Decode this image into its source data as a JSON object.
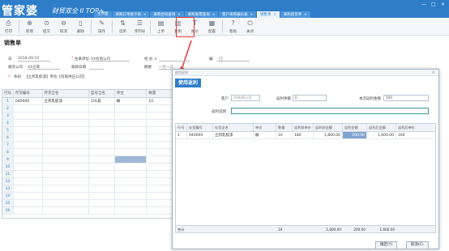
{
  "app": {
    "logo": "管家婆",
    "logo_sub": "财贸双全 II TOP+"
  },
  "tabs": [
    {
      "label": "主界面",
      "close": ""
    },
    {
      "label": "采购订单统计表",
      "close": "×"
    },
    {
      "label": "采购合同查询",
      "close": "×"
    },
    {
      "label": "采购发票查询",
      "close": "×"
    },
    {
      "label": "客户采购报价表",
      "close": "×"
    },
    {
      "label": "销售单",
      "close": "×"
    },
    {
      "label": "采购退货单",
      "close": "×"
    }
  ],
  "window_controls": {
    "minimize": "—",
    "maximize": "□",
    "close": "×"
  },
  "toolbar": {
    "buttons": [
      {
        "icon": "⎙",
        "label": "打印"
      },
      {
        "icon": "⊕",
        "label": "新增"
      },
      {
        "icon": "⊙",
        "label": "提交"
      },
      {
        "icon": "⊖",
        "label": "取消"
      },
      {
        "icon": "▯",
        "label": "删除"
      },
      {
        "icon": "✎",
        "label": "操作"
      },
      {
        "icon": "⇅",
        "label": "选单"
      },
      {
        "icon": "☰",
        "label": "序列号"
      },
      {
        "icon": "▤",
        "label": "上单"
      },
      {
        "icon": "▥",
        "label": "复制"
      },
      {
        "icon": "T",
        "label": "报价"
      },
      {
        "icon": "▦",
        "label": "配置"
      },
      {
        "icon": "?",
        "label": "帮助"
      },
      {
        "icon": "⏻",
        "label": "关闭"
      }
    ]
  },
  "doc": {
    "title": "销售单",
    "fields": {
      "date_label": "日",
      "date_value": "2018-09-10",
      "unit_label": "往来单位",
      "unit_value": "XX有限公司",
      "handler_label": "经 办 人",
      "doc_no_label": "编",
      "doc_no_value": "门",
      "dept_label": "收货公司",
      "dept_value": "XX仓库",
      "checkout_label": "收款日期",
      "summary_label": "摘要",
      "summary_value": "一月一日",
      "barcode_label": "条码",
      "barcode_value": "【立邦乳胶漆】单位【有限供应公司】"
    }
  },
  "main_grid": {
    "columns": [
      "行号",
      "存货编号",
      "存货全名",
      "型号全名",
      "单位",
      "数量"
    ],
    "rows": [
      [
        "1",
        "040000",
        "立邦乳胶漆",
        "10L套",
        "桶",
        "10"
      ],
      [
        "2",
        "",
        "",
        "",
        "",
        ""
      ],
      [
        "3",
        "",
        "",
        "",
        "",
        ""
      ],
      [
        "4",
        "",
        "",
        "",
        "",
        ""
      ],
      [
        "5",
        "",
        "",
        "",
        "",
        ""
      ],
      [
        "6",
        "",
        "",
        "",
        "",
        ""
      ],
      [
        "7",
        "",
        "",
        "",
        "",
        ""
      ],
      [
        "8",
        "",
        "",
        "",
        "",
        ""
      ],
      [
        "9",
        "",
        "",
        "",
        "",
        ""
      ],
      [
        "10",
        "",
        "",
        "",
        "",
        ""
      ],
      [
        "11",
        "",
        "",
        "",
        "",
        ""
      ],
      [
        "12",
        "",
        "",
        "",
        "",
        ""
      ],
      [
        "13",
        "",
        "",
        "",
        "",
        ""
      ],
      [
        "14",
        "",
        "",
        "",
        "",
        ""
      ],
      [
        "15",
        "",
        "",
        "",
        "",
        ""
      ],
      [
        "16",
        "",
        "",
        "",
        "",
        ""
      ]
    ]
  },
  "dialog": {
    "title": "使用返利",
    "header": "使用返利",
    "close": "×",
    "customer_label": "客户",
    "customer_value": "XX有限公司",
    "rebate_amount_label": "返利余额",
    "rebate_amount_value": "0",
    "this_rebate_label": "本次返利金额",
    "this_rebate_value": "500",
    "rebate_note_label": "返利说明",
    "rebate_note_value": "",
    "grid_columns": [
      "行号",
      "存货编号",
      "存货全名",
      "单位",
      "数量",
      "返利前单价",
      "返利前金额",
      "返利金额",
      "返利后金额",
      "返利后单价"
    ],
    "grid_rows": [
      [
        "1",
        "040000",
        "立邦乳胶漆",
        "桶",
        "10",
        "180",
        "1,800.00",
        "200.00",
        "1,600.00",
        "160"
      ]
    ],
    "total_label": "合计",
    "total_qty": "10",
    "total_before": "1,800.00",
    "total_rebate": "200.00",
    "total_after": "1,600.00",
    "ok_label": "确定(Y)",
    "cancel_label": "取消(C)"
  },
  "colors": {
    "brand": "#2d7dc9",
    "highlight": "#e53935",
    "selected_cell": "#7fa4d0"
  }
}
